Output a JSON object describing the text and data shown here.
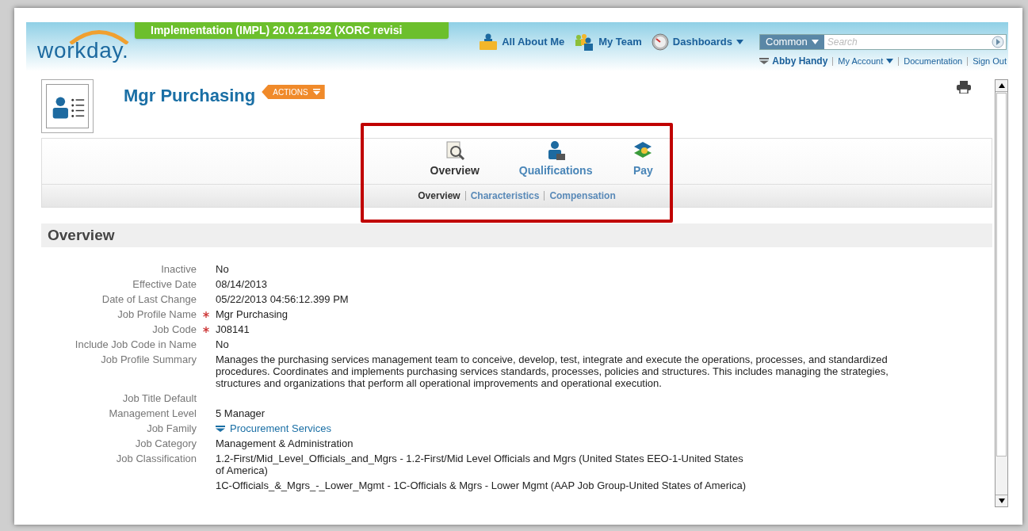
{
  "environment_banner": "Implementation (IMPL) 20.0.21.292 (XORC revisi",
  "logo": "workday.",
  "nav": [
    {
      "label": "All About Me",
      "kind": "person"
    },
    {
      "label": "My Team",
      "kind": "team"
    },
    {
      "label": "Dashboards",
      "kind": "dashboard"
    }
  ],
  "search": {
    "scope": "Common",
    "placeholder": "Search"
  },
  "user_links": [
    {
      "label": "Abby Handy",
      "kind": "user"
    },
    {
      "label": "My Account",
      "kind": "menu"
    },
    {
      "label": "Documentation",
      "kind": "link"
    },
    {
      "label": "Sign Out",
      "kind": "link"
    }
  ],
  "title": "Mgr Purchasing",
  "actions_button": "ACTIONS",
  "tabs": [
    {
      "label": "Overview",
      "selected": true,
      "kind": "overview"
    },
    {
      "label": "Qualifications",
      "selected": false,
      "kind": "qualifications"
    },
    {
      "label": "Pay",
      "selected": false,
      "kind": "pay"
    }
  ],
  "subtabs": [
    {
      "label": "Overview",
      "selected": true
    },
    {
      "label": "Characteristics",
      "selected": false
    },
    {
      "label": "Compensation",
      "selected": false
    }
  ],
  "section_title": "Overview",
  "fields": [
    {
      "label": "Inactive",
      "required": false,
      "kind": "text",
      "values": [
        "No"
      ]
    },
    {
      "label": "Effective Date",
      "required": false,
      "kind": "text",
      "values": [
        "08/14/2013"
      ]
    },
    {
      "label": "Date of Last Change",
      "required": false,
      "kind": "text",
      "values": [
        "05/22/2013 04:56:12.399 PM"
      ]
    },
    {
      "label": "Job Profile Name",
      "required": true,
      "kind": "text",
      "values": [
        "Mgr Purchasing"
      ]
    },
    {
      "label": "Job Code",
      "required": true,
      "kind": "text",
      "values": [
        "J08141"
      ]
    },
    {
      "label": "Include Job Code in Name",
      "required": false,
      "kind": "text",
      "values": [
        "No"
      ]
    },
    {
      "label": "Job Profile Summary",
      "required": false,
      "kind": "text",
      "values": [
        "Manages the purchasing services management team to conceive, develop, test, integrate and execute the operations, processes, and standardized procedures.  Coordinates and implements purchasing services standards, processes, policies and structures.  This includes managing the strategies, structures and organizations that perform all operational improvements and operational execution."
      ]
    },
    {
      "label": "Job Title Default",
      "required": false
    },
    {
      "label": "Management Level",
      "required": false,
      "kind": "text",
      "values": [
        "5 Manager"
      ]
    },
    {
      "label": "Job Family",
      "required": false,
      "kind": "link",
      "values": [
        "Procurement Services"
      ]
    },
    {
      "label": "Job Category",
      "required": false,
      "kind": "text",
      "values": [
        "Management & Administration"
      ]
    },
    {
      "label": "Job Classification",
      "required": false,
      "kind": "text",
      "values": [
        "1.2-First/Mid_Level_Officials_and_Mgrs - 1.2-First/Mid Level Officials and Mgrs (United States EEO-1-United States of America)",
        "1C-Officials_&_Mgrs_-_Lower_Mgmt - 1C-Officials & Mgrs - Lower Mgmt (AAP Job Group-United States of America)"
      ]
    }
  ]
}
